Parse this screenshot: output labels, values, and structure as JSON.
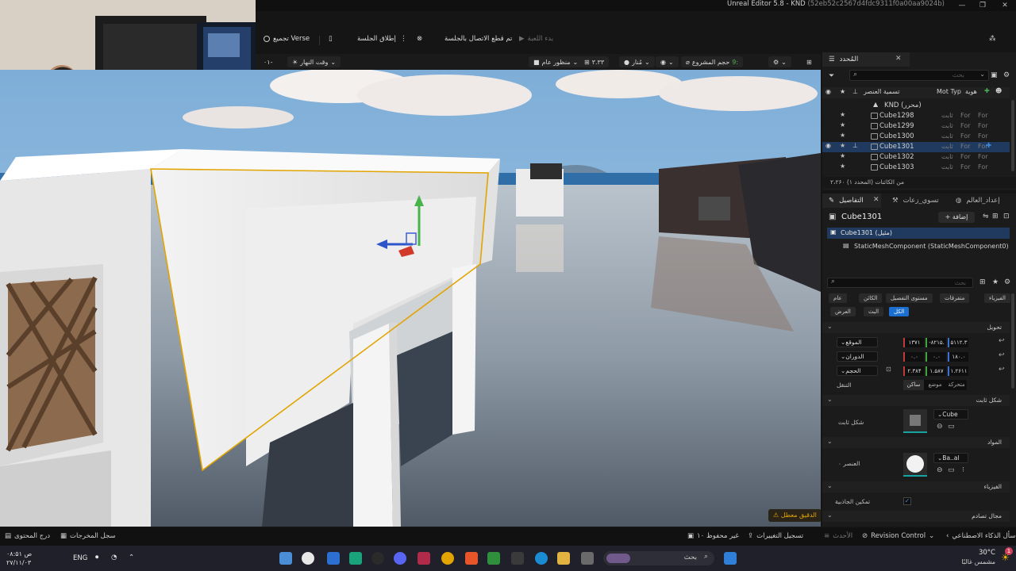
{
  "window": {
    "title": "Unreal Editor 5.8 - KND",
    "title_id": "(52eb52c2567d4fdc9311f0a00aa9024b)",
    "controls": [
      "—",
      "❐",
      "✕"
    ]
  },
  "toolbar": {
    "verse": "تجميع Verse",
    "launch_session": "إطلاق الجلسة",
    "session_status": "تم قطع الاتصال بالجلسة",
    "start_game": "بدء اللعبة"
  },
  "viewport_toolbar": {
    "time_of_day": "وقت النهار",
    "perspective": "منظور عام",
    "lit": "مُنار",
    "scale": "۳.۳۳",
    "project_size": "حجم المشروع",
    "project_size_value": "9:",
    "zoom_label": "۰۱-"
  },
  "viewport": {
    "warning": "الدقيق معطل"
  },
  "outliner": {
    "tab": "المُحدد",
    "search_placeholder": "بحث",
    "col_name": "تسمية العنصر",
    "col_type": "Mot Typ",
    "col_id": "هوية",
    "root": "KND (محرر)",
    "rows": [
      {
        "name": "Cube1298",
        "type": "ثابت",
        "t1": "For",
        "t2": "For"
      },
      {
        "name": "Cube1299",
        "type": "ثابت",
        "t1": "For",
        "t2": "For"
      },
      {
        "name": "Cube1300",
        "type": "ثابت",
        "t1": "For",
        "t2": "For"
      },
      {
        "name": "Cube1301",
        "type": "ثابت",
        "t1": "For",
        "t2": "For"
      },
      {
        "name": "Cube1302",
        "type": "ثابت",
        "t1": "For",
        "t2": "For"
      },
      {
        "name": "Cube1303",
        "type": "ثابت",
        "t1": "For",
        "t2": "For"
      }
    ],
    "footer": "۲،۲۶۰ من الكائنات (المحدد ۱)"
  },
  "details": {
    "tabs": [
      "التفاصيل",
      "تسوي_زعات",
      "إعداد_العالم"
    ],
    "object_name": "Cube1301",
    "add_button": "+ إضافة",
    "instance_row": "Cube1301 (مثيل)",
    "component_row": "StaticMeshComponent (StaticMeshComponent0)",
    "search_placeholder": "بحث",
    "filters_row1": [
      "الفيزياء",
      "متفرقات",
      "مستوى التفصيل",
      "الكائن",
      "عام"
    ],
    "filters_row2": [
      "الكل",
      "البث",
      "العرض"
    ],
    "transform_header": "تحويل",
    "location_label": "الموقع",
    "rotation_label": "الدوران",
    "scale_label": "الحجم",
    "location_values": [
      "۵۱۱۲.۳",
      "-۸۲۱۵.",
      "۱۳۷۱"
    ],
    "rotation_values": [
      "۱۸۰.۰",
      "۰.۰",
      "۰.۰"
    ],
    "scale_values": [
      "۱.۲۶۱۱",
      "۱.۵۸۷",
      "۲.۳۸۴"
    ],
    "mobility_label": "التنقل",
    "mobility_options": [
      "متحركة",
      "موضع",
      "ساكن"
    ],
    "static_mesh_header": "شكل ثابت",
    "static_mesh_label": "شكل ثابت",
    "static_mesh_value": "Cube",
    "materials_header": "المواد",
    "element_label": "العنصر ۰",
    "material_value": "Ba..al",
    "physics_header": "الفيزياء",
    "gravity_label": "تمكين الجاذبية",
    "collision_header": "مجال تصادم"
  },
  "statusbar": {
    "content_drawer": "درج المحتوى",
    "output_log": "سجل المخرجات",
    "unsaved": "۱۰ غير محفوظ",
    "changes_log": "تسجيل التغييرات",
    "recent": "الأحدث",
    "revision_control": "Revision Control",
    "ai_questions": "أسأل الذكاء الاصطناعي"
  },
  "taskbar": {
    "weather_temp": "30°C",
    "weather_text": "مشمس غالبًا",
    "notification_count": "1",
    "search_placeholder": "بحث",
    "lang": "ENG",
    "time": "۰۸:۵۱ ص",
    "date": "۲۷/۱۱/۰۳"
  },
  "colors": {
    "accent": "#1b6fd1",
    "selection": "#1f3a5e",
    "x_axis": "#c23b3b",
    "y_axis": "#3fa33f",
    "z_axis": "#3d6fd6",
    "gizmo_selection": "#e6a100"
  }
}
